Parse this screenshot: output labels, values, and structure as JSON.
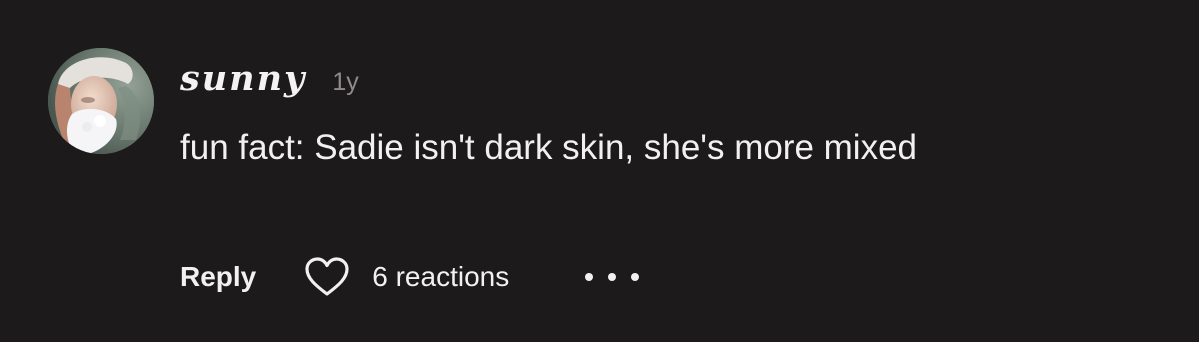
{
  "comment": {
    "username": "sunny",
    "timestamp": "1y",
    "text": "fun fact: Sadie isn't dark skin, she's more mixed",
    "avatar_icon": "profile-photo"
  },
  "actions": {
    "reply_label": "Reply",
    "reactions_label": "6 reactions",
    "heart_icon": "heart-outline-icon",
    "more_icon": "more-options-icon"
  },
  "colors": {
    "background": "#1c1a1b",
    "primary_text": "#f2f0f0",
    "secondary_text": "#8f8b8c"
  }
}
